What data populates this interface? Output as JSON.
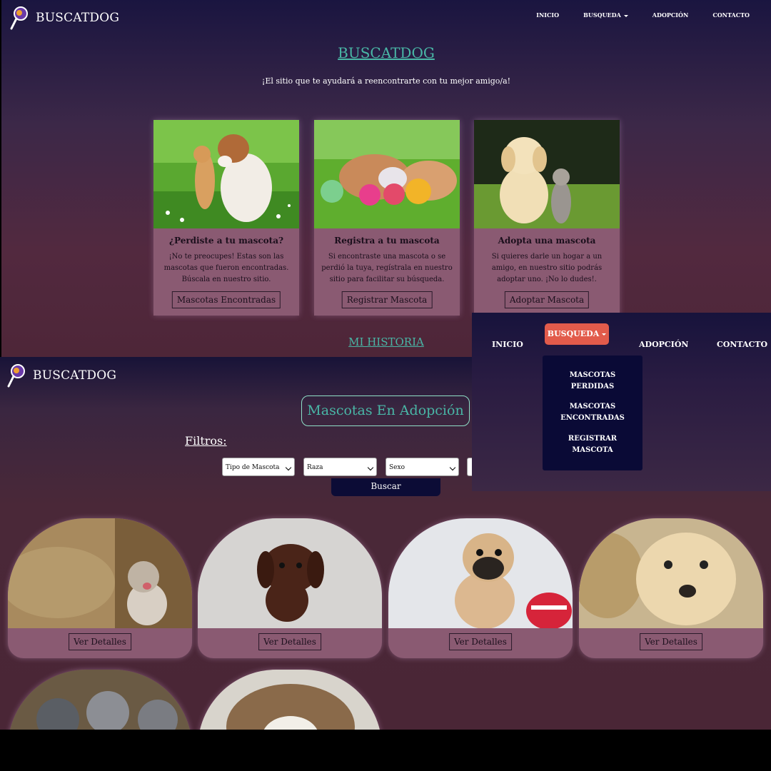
{
  "home": {
    "brand": "BUSCATDOG",
    "nav": [
      "INICIO",
      "BUSQUEDA",
      "ADOPCIÓN",
      "CONTACTO"
    ],
    "title": "BUSCATDOG",
    "subtitle": "¡El sitio que te ayudará a reencontrarte con tu mejor amigo/a!",
    "cards": [
      {
        "title": "¿Perdiste a tu mascota?",
        "text": "¡No te preocupes! Estas son las mascotas que fueron encontradas. Búscala en nuestro sitio.",
        "button": "Mascotas Encontradas"
      },
      {
        "title": "Registra a tu mascota",
        "text": "Si encontraste una mascota o se perdió la tuya, regístrala en nuestro sitio para facilitar su búsqueda.",
        "button": "Registrar Mascota"
      },
      {
        "title": "Adopta una mascota",
        "text": "Si quieres darle un hogar a un amigo, en nuestro sitio podrás adoptar uno. ¡No lo dudes!.",
        "button": "Adoptar Mascota"
      }
    ],
    "section_link": "MI HISTORIA"
  },
  "menu": {
    "links": [
      "INICIO",
      "BUSQUEDA",
      "ADOPCIÓN",
      "CONTACTO"
    ],
    "dropdown": [
      [
        "MASCOTAS",
        "PERDIDAS"
      ],
      [
        "MASCOTAS",
        "ENCONTRADAS"
      ],
      [
        "REGISTRAR",
        "MASCOTA"
      ]
    ],
    "active_color": "#e25b4b"
  },
  "adopt": {
    "brand": "BUSCATDOG",
    "title": "Mascotas En Adopción",
    "filters_label": "Filtros:",
    "filters": [
      "Tipo de Mascota",
      "Raza",
      "Sexo"
    ],
    "search_button": "Buscar",
    "pets": [
      {
        "button": "Ver Detalles",
        "icon": "kitten-photo"
      },
      {
        "button": "Ver Detalles",
        "icon": "puppy-photo"
      },
      {
        "button": "Ver Detalles",
        "icon": "pug-photo"
      },
      {
        "button": "Ver Detalles",
        "icon": "retriever-photo"
      },
      {
        "icon": "kittens-photo"
      },
      {
        "icon": "cat-photo"
      }
    ]
  },
  "colors": {
    "accent": "#49b6a6",
    "card": "#8a5a72",
    "dropdown": "#0a0a36"
  }
}
